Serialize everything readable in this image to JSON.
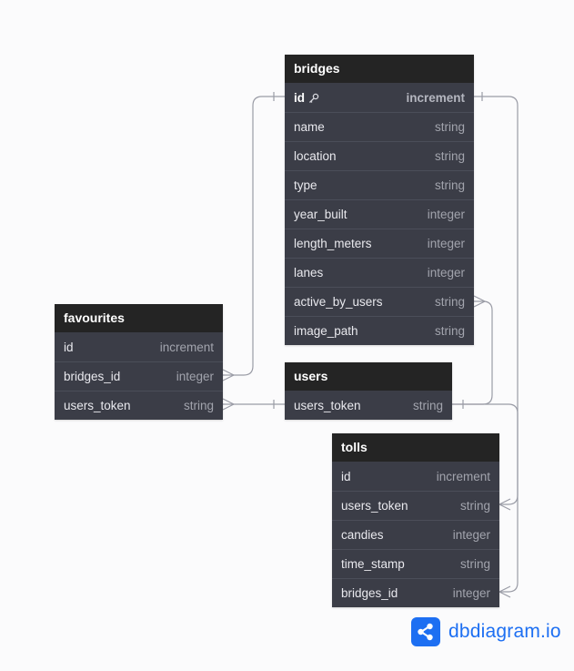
{
  "tables": {
    "bridges": {
      "name": "bridges",
      "fields": [
        {
          "name": "id",
          "type": "increment"
        },
        {
          "name": "name",
          "type": "string"
        },
        {
          "name": "location",
          "type": "string"
        },
        {
          "name": "type",
          "type": "string"
        },
        {
          "name": "year_built",
          "type": "integer"
        },
        {
          "name": "length_meters",
          "type": "integer"
        },
        {
          "name": "lanes",
          "type": "integer"
        },
        {
          "name": "active_by_users",
          "type": "string"
        },
        {
          "name": "image_path",
          "type": "string"
        }
      ]
    },
    "favourites": {
      "name": "favourites",
      "fields": [
        {
          "name": "id",
          "type": "increment"
        },
        {
          "name": "bridges_id",
          "type": "integer"
        },
        {
          "name": "users_token",
          "type": "string"
        }
      ]
    },
    "users": {
      "name": "users",
      "fields": [
        {
          "name": "users_token",
          "type": "string"
        }
      ]
    },
    "tolls": {
      "name": "tolls",
      "fields": [
        {
          "name": "id",
          "type": "increment"
        },
        {
          "name": "users_token",
          "type": "string"
        },
        {
          "name": "candies",
          "type": "integer"
        },
        {
          "name": "time_stamp",
          "type": "string"
        },
        {
          "name": "bridges_id",
          "type": "integer"
        }
      ]
    }
  },
  "brand": {
    "name": "dbdiagram.io",
    "color": "#1d6ff2"
  },
  "colors": {
    "header_bg": "#242424",
    "body_bg": "#3b3d47",
    "connector": "#9a9ca6"
  },
  "icons": {
    "primary_key": "key-icon",
    "brand_logo": "share-nodes-icon"
  }
}
